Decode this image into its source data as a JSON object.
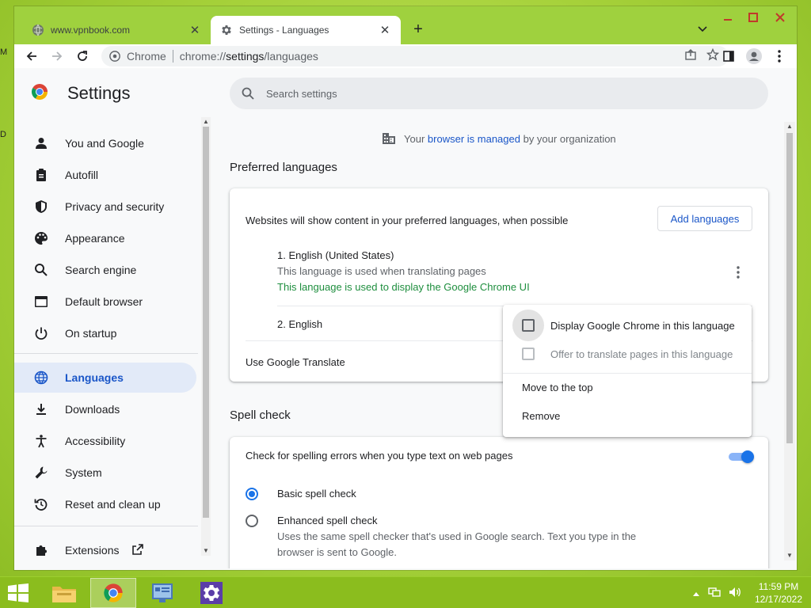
{
  "desktop": {
    "label_a": "M",
    "label_b": "D"
  },
  "tabs": [
    {
      "title": "www.vpnbook.com",
      "favicon": "globe-icon",
      "active": false
    },
    {
      "title": "Settings - Languages",
      "favicon": "gear-icon",
      "active": true
    }
  ],
  "omnibox": {
    "site_name": "Chrome",
    "url_scheme": "chrome://",
    "url_host": "settings",
    "url_path": "/languages"
  },
  "settings": {
    "title": "Settings",
    "search_placeholder": "Search settings"
  },
  "sidebar": {
    "items": [
      {
        "label": "You and Google",
        "icon": "person-icon"
      },
      {
        "label": "Autofill",
        "icon": "clipboard-icon"
      },
      {
        "label": "Privacy and security",
        "icon": "shield-icon"
      },
      {
        "label": "Appearance",
        "icon": "palette-icon"
      },
      {
        "label": "Search engine",
        "icon": "search-icon"
      },
      {
        "label": "Default browser",
        "icon": "browser-window-icon"
      },
      {
        "label": "On startup",
        "icon": "power-icon"
      },
      {
        "label": "Languages",
        "icon": "globe-icon",
        "selected": true
      },
      {
        "label": "Downloads",
        "icon": "download-icon"
      },
      {
        "label": "Accessibility",
        "icon": "accessibility-icon"
      },
      {
        "label": "System",
        "icon": "wrench-icon"
      },
      {
        "label": "Reset and clean up",
        "icon": "reset-icon"
      },
      {
        "label": "Extensions",
        "icon": "puzzle-icon"
      }
    ]
  },
  "managed": {
    "prefix": "Your ",
    "link": "browser is managed",
    "suffix": " by your organization"
  },
  "preferred_languages": {
    "title": "Preferred languages",
    "description": "Websites will show content in your preferred languages, when possible",
    "add_button": "Add languages",
    "languages": [
      {
        "name": "1. English (United States)",
        "note1": "This language is used when translating pages",
        "note2": "This language is used to display the Google Chrome UI"
      },
      {
        "name": "2. English"
      }
    ],
    "translate_label": "Use Google Translate"
  },
  "spell_check": {
    "title": "Spell check",
    "toggle_label": "Check for spelling errors when you type text on web pages",
    "toggle_on": true,
    "options": [
      {
        "label": "Basic spell check",
        "selected": true
      },
      {
        "label": "Enhanced spell check",
        "selected": false,
        "description_line1": "Uses the same spell checker that's used in Google search. Text you type in the",
        "description_line2": "browser is sent to Google."
      }
    ]
  },
  "context_menu": {
    "items": [
      {
        "label": "Display Google Chrome in this language",
        "type": "checkbox",
        "checked": false,
        "disabled": false
      },
      {
        "label": "Offer to translate pages in this language",
        "type": "checkbox",
        "checked": false,
        "disabled": true
      },
      {
        "label": "Move to the top",
        "type": "action"
      },
      {
        "label": "Remove",
        "type": "action"
      }
    ]
  },
  "taskbar": {
    "clock_time": "11:59 PM",
    "clock_date": "12/17/2022"
  },
  "colors": {
    "accent": "#1a73e8",
    "link": "#1a56c8",
    "green": "#1e8e3e",
    "tabstrip": "#9fd13e"
  }
}
